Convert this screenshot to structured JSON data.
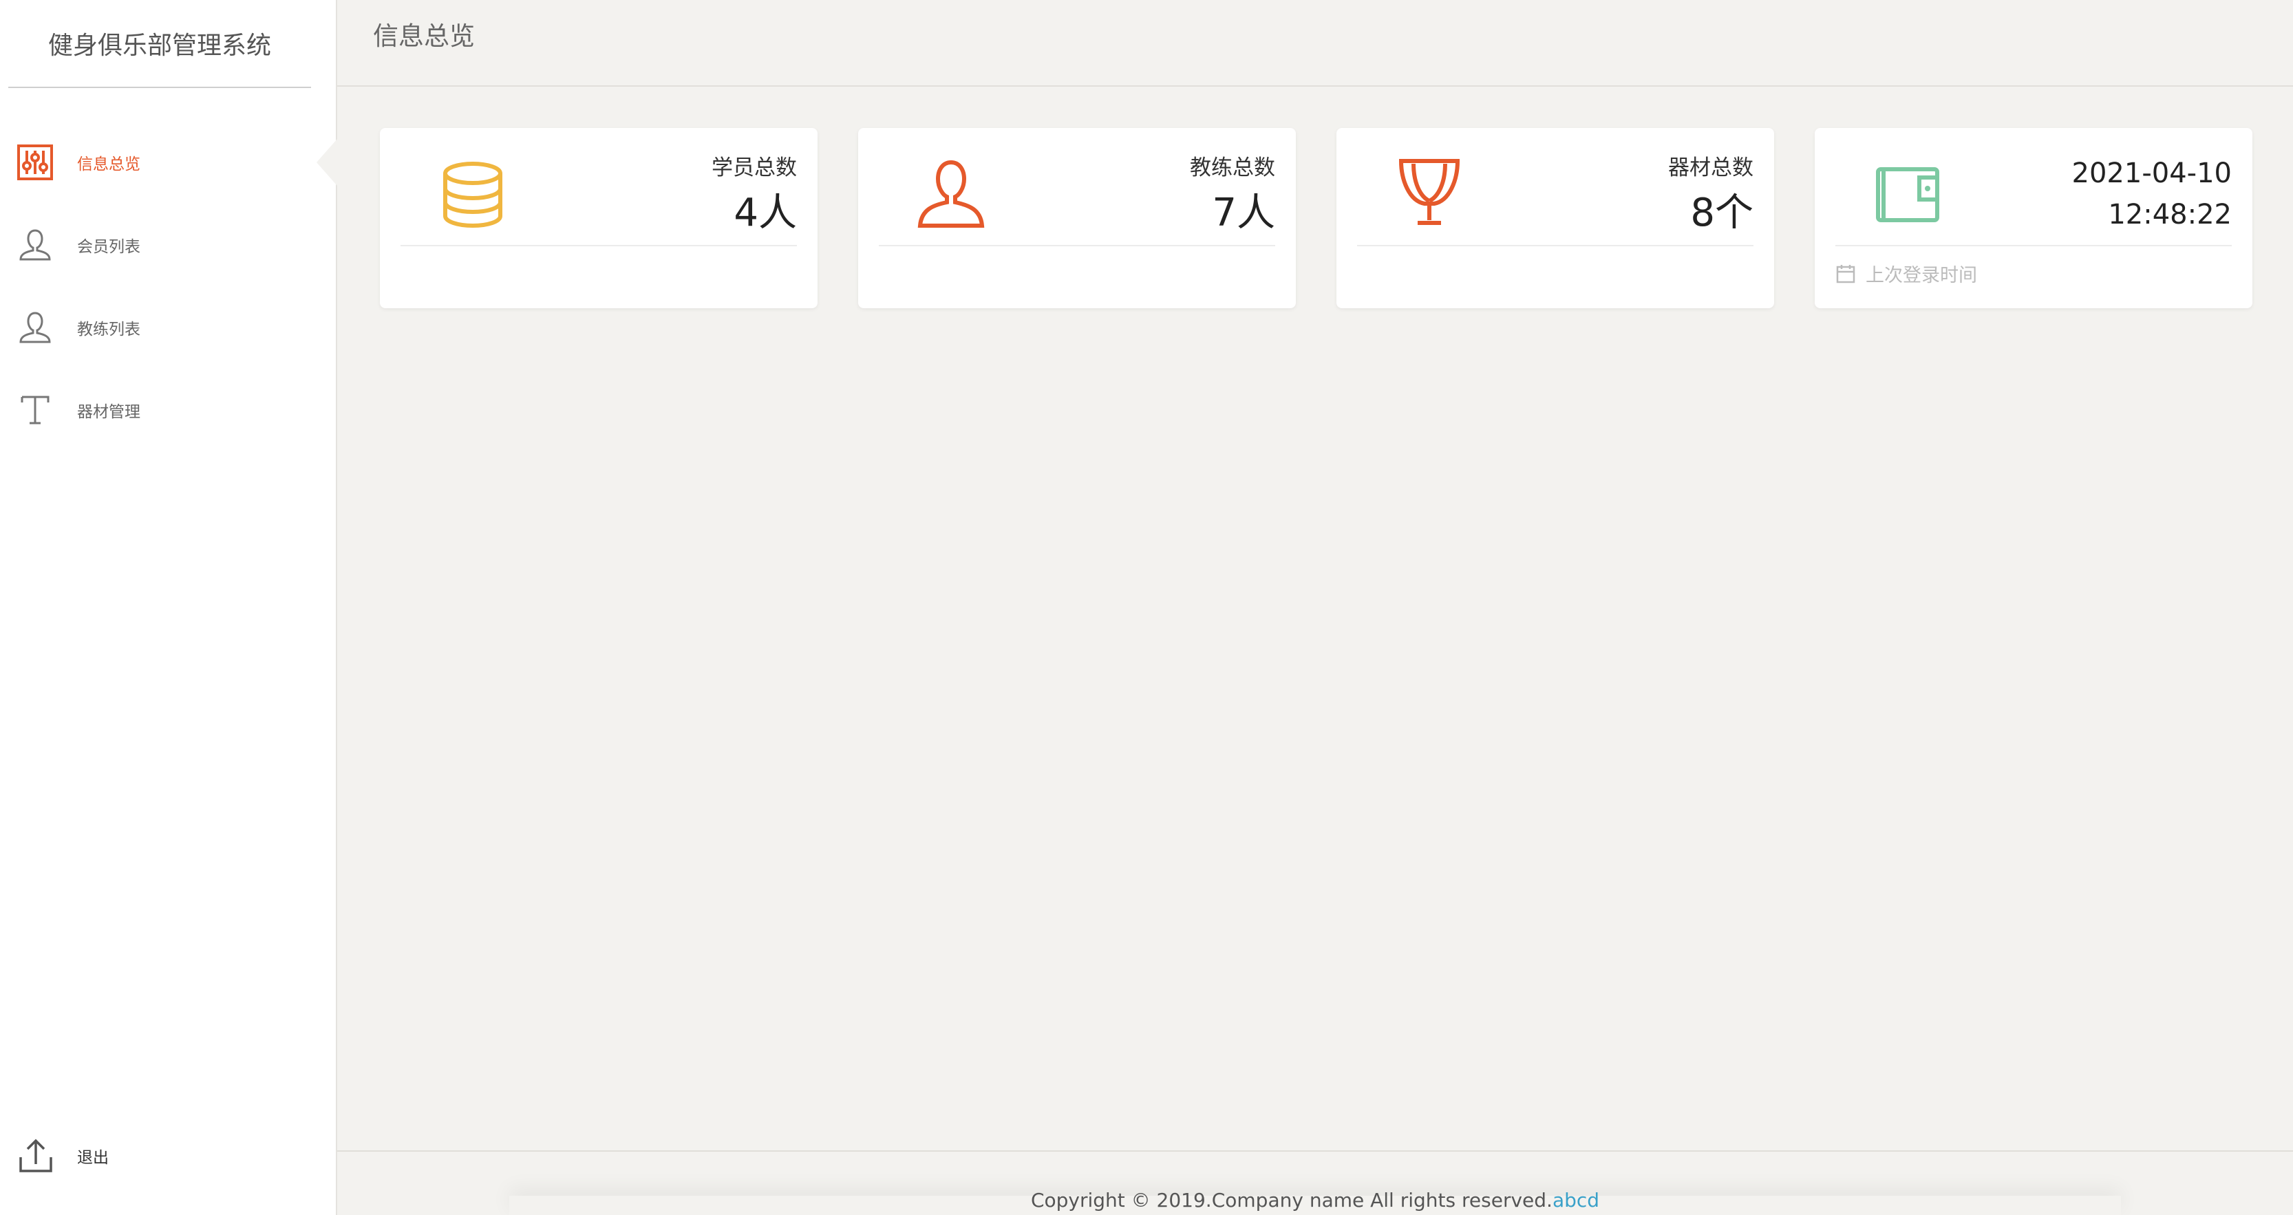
{
  "app": {
    "title": "健身俱乐部管理系统"
  },
  "sidebar": {
    "items": [
      {
        "label": "信息总览",
        "icon": "sliders-icon",
        "active": true
      },
      {
        "label": "会员列表",
        "icon": "user-icon",
        "active": false
      },
      {
        "label": "教练列表",
        "icon": "user-icon",
        "active": false
      },
      {
        "label": "器材管理",
        "icon": "text-t-icon",
        "active": false
      }
    ],
    "logout": {
      "label": "退出",
      "icon": "upload-icon"
    }
  },
  "header": {
    "title": "信息总览"
  },
  "stats": [
    {
      "title": "学员总数",
      "value": "4人",
      "icon": "database-icon",
      "color": "#f0b63f"
    },
    {
      "title": "教练总数",
      "value": "7人",
      "icon": "user-icon",
      "color": "#e5592b"
    },
    {
      "title": "器材总数",
      "value": "8个",
      "icon": "trophy-icon",
      "color": "#e5592b"
    }
  ],
  "last_login": {
    "date": "2021-04-10",
    "time": "12:48:22",
    "label": "上次登录时间",
    "icon": "wallet-icon",
    "color": "#7cc9a1"
  },
  "footer": {
    "copyright": "Copyright © 2019.Company name All rights reserved.",
    "link": "abcd"
  },
  "colors": {
    "accent": "#e5592b",
    "background": "#f3f2ef"
  }
}
